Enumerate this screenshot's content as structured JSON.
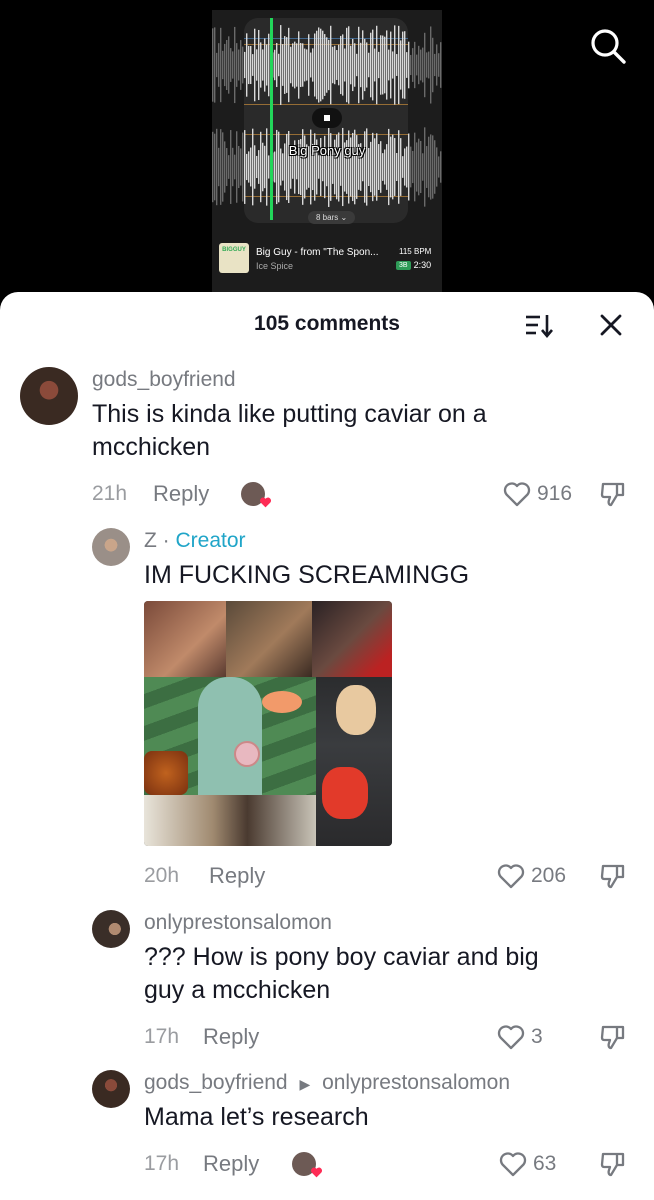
{
  "video": {
    "caption": "Big Pony guy",
    "bars_label": "8 bars ⌄",
    "song": {
      "art_text": "BIGGUY",
      "title": "Big Guy - from \"The Spon...",
      "artist": "Ice Spice",
      "bpm": "115 BPM",
      "key_badge": "3B",
      "duration": "2:30"
    },
    "search_icon": "search-icon"
  },
  "comments_header": {
    "count_label": "105 comments",
    "sort_icon": "sort-icon",
    "close_icon": "close-icon"
  },
  "comments": [
    {
      "username": "gods_boyfriend",
      "text_line1": "This is kinda like putting caviar on a",
      "text_line2": "mcchicken",
      "time": "21h",
      "reply_label": "Reply",
      "likes": "916"
    },
    {
      "username": "Z",
      "separator": "·",
      "creator_label": "Creator",
      "text_line1": "IM FUCKING SCREAMINGG",
      "time": "20h",
      "reply_label": "Reply",
      "likes": "206"
    },
    {
      "username": "onlyprestonsalomon",
      "text_line1": "??? How is pony boy caviar and big",
      "text_line2": "guy a mcchicken",
      "time": "17h",
      "reply_label": "Reply",
      "likes": "3"
    },
    {
      "username": "gods_boyfriend",
      "reply_to": "onlyprestonsalomon",
      "text_line1": "Mama let’s research",
      "time": "17h",
      "reply_label": "Reply",
      "likes": "63"
    }
  ],
  "colors": {
    "creator": "#20a5c8",
    "like_heart": "#fe2c55",
    "text": "#161823",
    "muted": "#777a80"
  }
}
